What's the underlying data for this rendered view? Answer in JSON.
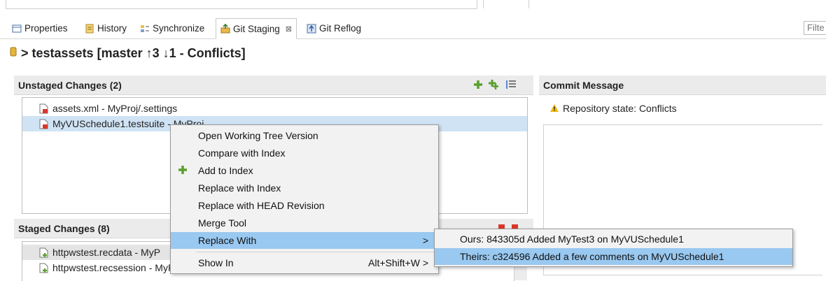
{
  "tabs": [
    {
      "label": "Properties",
      "icon": "properties-icon"
    },
    {
      "label": "History",
      "icon": "history-icon"
    },
    {
      "label": "Synchronize",
      "icon": "synchronize-icon"
    },
    {
      "label": "Git Staging",
      "icon": "git-staging-icon",
      "close": "⊠"
    },
    {
      "label": "Git Reflog",
      "icon": "git-reflog-icon"
    }
  ],
  "filter_placeholder": "Filte",
  "repo": {
    "title": "> testassets [master ↑3 ↓1 - Conflicts]"
  },
  "unstaged": {
    "header": "Unstaged Changes (2)",
    "items": [
      {
        "label": "assets.xml - MyProj/.settings"
      },
      {
        "label": "MyVUSchedule1.testsuite - MyProj"
      }
    ]
  },
  "staged": {
    "header": "Staged Changes (8)",
    "items": [
      {
        "label": "httpwstest.recdata - MyP"
      },
      {
        "label": "httpwstest.recsession - MyProj"
      }
    ]
  },
  "commit": {
    "header": "Commit Message",
    "repo_state": "Repository state: Conflicts"
  },
  "context_menu": {
    "items": [
      {
        "label": "Open Working Tree Version"
      },
      {
        "label": "Compare with Index"
      },
      {
        "label": "Add to Index"
      },
      {
        "label": "Replace with Index"
      },
      {
        "label": "Replace with HEAD Revision"
      },
      {
        "label": "Merge Tool"
      },
      {
        "label": "Replace With",
        "arrow": ">"
      },
      {
        "label": "Show In",
        "shortcut": "Alt+Shift+W >"
      }
    ]
  },
  "submenu": {
    "items": [
      {
        "label": "Ours: 843305d Added MyTest3 on MyVUSchedule1"
      },
      {
        "label": "Theirs: c324596 Added a few comments on MyVUSchedule1"
      }
    ]
  },
  "colors": {
    "menu_highlight": "#99c8f0",
    "selection": "#cfe3f5",
    "header_bg": "#ebebeb",
    "add_green": "#5aa02c"
  }
}
